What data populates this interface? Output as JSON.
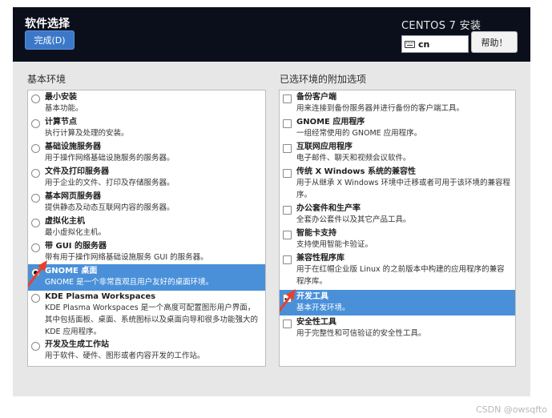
{
  "header": {
    "title": "软件选择",
    "done_label": "完成(D)",
    "product": "CENTOS 7 安装",
    "keyboard_layout": "cn",
    "help_label": "帮助！"
  },
  "left_panel": {
    "title": "基本环境",
    "items": [
      {
        "name": "最小安装",
        "desc": "基本功能。",
        "selected": false
      },
      {
        "name": "计算节点",
        "desc": "执行计算及处理的安装。",
        "selected": false
      },
      {
        "name": "基础设施服务器",
        "desc": "用于操作网络基础设施服务的服务器。",
        "selected": false
      },
      {
        "name": "文件及打印服务器",
        "desc": "用于企业的文件、打印及存储服务器。",
        "selected": false
      },
      {
        "name": "基本网页服务器",
        "desc": "提供静态及动态互联网内容的服务器。",
        "selected": false
      },
      {
        "name": "虚拟化主机",
        "desc": "最小虚拟化主机。",
        "selected": false
      },
      {
        "name": "带 GUI 的服务器",
        "desc": "带有用于操作网络基础设施服务 GUI 的服务器。",
        "selected": false
      },
      {
        "name": "GNOME 桌面",
        "desc": "GNOME 是一个非常直观且用户友好的桌面环境。",
        "selected": true
      },
      {
        "name": "KDE Plasma Workspaces",
        "desc": "KDE Plasma Workspaces 是一个高度可配置图形用户界面，其中包括面板、桌面、系统图标以及桌面向导和很多功能强大的 KDE 应用程序。",
        "selected": false
      },
      {
        "name": "开发及生成工作站",
        "desc": "用于软件、硬件、图形或者内容开发的工作站。",
        "selected": false
      }
    ]
  },
  "right_panel": {
    "title": "已选环境的附加选项",
    "items": [
      {
        "name": "备份客户端",
        "desc": "用来连接到备份服务器并进行备份的客户端工具。",
        "checked": false
      },
      {
        "name": "GNOME 应用程序",
        "desc": "一组经常使用的 GNOME 应用程序。",
        "checked": false
      },
      {
        "name": "互联网应用程序",
        "desc": "电子邮件、聊天和视频会议软件。",
        "checked": false
      },
      {
        "name": "传统 X Windows 系统的兼容性",
        "desc": "用于从继承 X Windows 环境中迁移或者可用于该环境的兼容程序。",
        "checked": false
      },
      {
        "name": "办公套件和生产率",
        "desc": "全套办公套件以及其它产品工具。",
        "checked": false
      },
      {
        "name": "智能卡支持",
        "desc": "支持使用智能卡验证。",
        "checked": false
      },
      {
        "name": "兼容性程序库",
        "desc": "用于在红帽企业版 Linux 的之前版本中构建的应用程序的兼容程序库。",
        "checked": false
      },
      {
        "name": "开发工具",
        "desc": "基本开发环境。",
        "checked": true
      },
      {
        "name": "安全性工具",
        "desc": "用于完整性和可信验证的安全性工具。",
        "checked": false
      }
    ]
  },
  "colors": {
    "selection": "#4a90d9",
    "done_button": "#3b78c9",
    "annotation_arrow": "#e8402b",
    "frame": "#0b0f1c",
    "content_bg": "#e7e7e7"
  },
  "watermark": "CSDN @owsqfto"
}
